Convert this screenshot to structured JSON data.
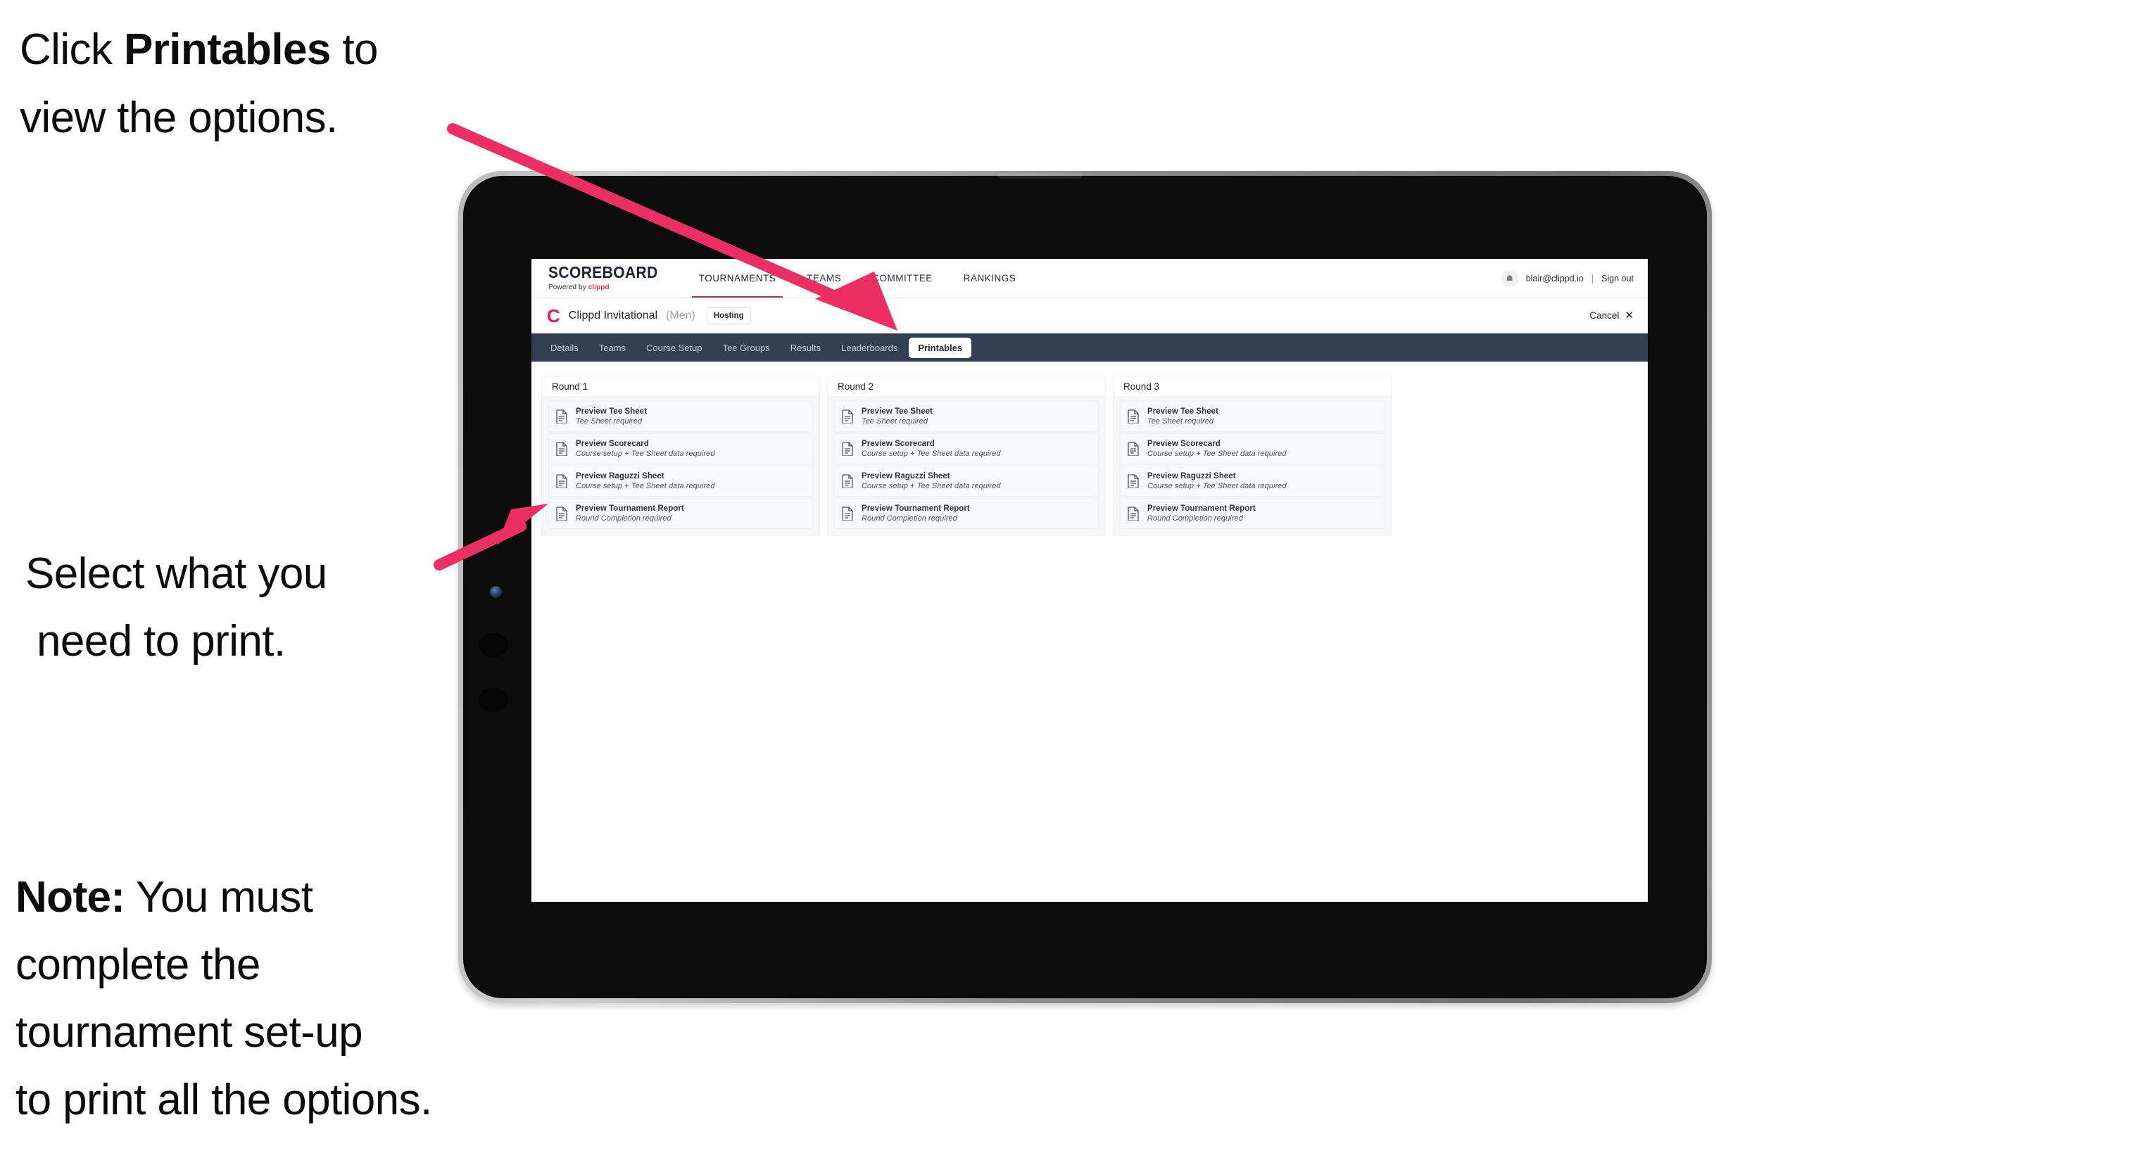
{
  "annotations": {
    "click_printables": {
      "line1_prefix": "Click ",
      "line1_bold": "Printables",
      "line1_suffix": " to",
      "line2": "view the options."
    },
    "select_print": {
      "line1": "Select what you",
      "line2": "need to print."
    },
    "note": {
      "label": "Note:",
      "line1_rest": " You must",
      "line2": "complete the",
      "line3": "tournament set-up",
      "line4": "to print all the options."
    },
    "arrow_color": "#ec2f63"
  },
  "app": {
    "brand": {
      "title": "SCOREBOARD",
      "powered_prefix": "Powered by ",
      "powered_brand": "clippd"
    },
    "top_nav": [
      {
        "label": "TOURNAMENTS",
        "active": true
      },
      {
        "label": "TEAMS",
        "active": false
      },
      {
        "label": "COMMITTEE",
        "active": false
      },
      {
        "label": "RANKINGS",
        "active": false
      }
    ],
    "account": {
      "avatar_glyph": "☗",
      "email": "blair@clippd.io",
      "separator": "|",
      "sign_out": "Sign out"
    },
    "tournament_bar": {
      "logo_glyph": "C",
      "name": "Clippd Invitational",
      "gender": "(Men)",
      "status": "Hosting",
      "cancel_label": "Cancel",
      "cancel_icon": "✕"
    },
    "tabs": [
      {
        "label": "Details",
        "active": false
      },
      {
        "label": "Teams",
        "active": false
      },
      {
        "label": "Course Setup",
        "active": false
      },
      {
        "label": "Tee Groups",
        "active": false
      },
      {
        "label": "Results",
        "active": false
      },
      {
        "label": "Leaderboards",
        "active": false
      },
      {
        "label": "Printables",
        "active": true
      }
    ],
    "rounds": [
      {
        "title": "Round 1",
        "items": [
          {
            "title": "Preview Tee Sheet",
            "subtitle": "Tee Sheet required"
          },
          {
            "title": "Preview Scorecard",
            "subtitle": "Course setup + Tee Sheet data required"
          },
          {
            "title": "Preview Raguzzi Sheet",
            "subtitle": "Course setup + Tee Sheet data required"
          },
          {
            "title": "Preview Tournament Report",
            "subtitle": "Round Completion required"
          }
        ]
      },
      {
        "title": "Round 2",
        "items": [
          {
            "title": "Preview Tee Sheet",
            "subtitle": "Tee Sheet required"
          },
          {
            "title": "Preview Scorecard",
            "subtitle": "Course setup + Tee Sheet data required"
          },
          {
            "title": "Preview Raguzzi Sheet",
            "subtitle": "Course setup + Tee Sheet data required"
          },
          {
            "title": "Preview Tournament Report",
            "subtitle": "Round Completion required"
          }
        ]
      },
      {
        "title": "Round 3",
        "items": [
          {
            "title": "Preview Tee Sheet",
            "subtitle": "Tee Sheet required"
          },
          {
            "title": "Preview Scorecard",
            "subtitle": "Course setup + Tee Sheet data required"
          },
          {
            "title": "Preview Raguzzi Sheet",
            "subtitle": "Course setup + Tee Sheet data required"
          },
          {
            "title": "Preview Tournament Report",
            "subtitle": "Round Completion required"
          }
        ]
      }
    ],
    "colors": {
      "tabstrip_bg": "#323e52",
      "accent_pink": "#e01e5a",
      "nav_underline": "#b4314f"
    }
  }
}
